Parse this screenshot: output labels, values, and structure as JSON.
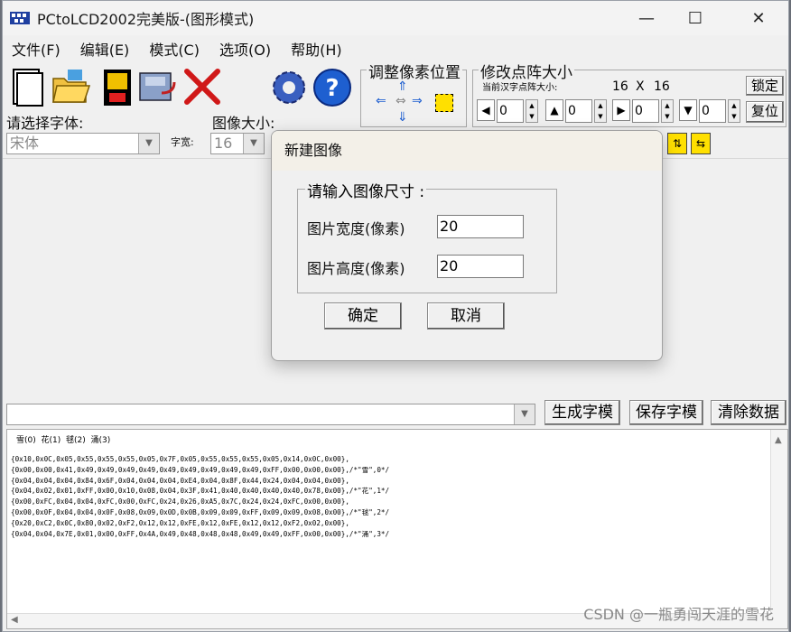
{
  "window": {
    "title": "PCtoLCD2002完美版-(图形模式)",
    "minimize": "—",
    "maximize": "☐",
    "close": "✕"
  },
  "menu": [
    "文件(F)",
    "编辑(E)",
    "模式(C)",
    "选项(O)",
    "帮助(H)"
  ],
  "pixel_group": {
    "title": "调整像素位置"
  },
  "matrix_group": {
    "title": "修改点阵大小",
    "current_label": "当前汉字点阵大小:",
    "current_w": "16",
    "x_sep": "X",
    "current_h": "16",
    "lock_button": "锁定",
    "reset_button": "复位",
    "spin_values": [
      "0",
      "0",
      "0",
      "0"
    ]
  },
  "font_select": {
    "label": "请选择字体:",
    "value": "宋体"
  },
  "width_select": {
    "label": "字宽:",
    "value": "16"
  },
  "image_size_label": "图像大小:",
  "bottom": {
    "generate": "生成字模",
    "save": "保存字模",
    "clear": "清除数据"
  },
  "output": {
    "chars": [
      "雪(0)",
      "花(1)",
      "毬(2)",
      "涌(3)"
    ],
    "lines": [
      "{0x10,0x0C,0x05,0x55,0x55,0x55,0x05,0x7F,0x05,0x55,0x55,0x55,0x05,0x14,0x0C,0x00},",
      "{0x00,0x00,0x41,0x49,0x49,0x49,0x49,0x49,0x49,0x49,0x49,0x49,0xFF,0x00,0x00,0x00},/*\"雪\",0*/",
      "{0x04,0x04,0x04,0x84,0x6F,0x04,0x04,0x04,0xE4,0x04,0x8F,0x44,0x24,0x04,0x04,0x00},",
      "{0x04,0x02,0x01,0xFF,0x00,0x10,0x08,0x04,0x3F,0x41,0x40,0x40,0x40,0x40,0x78,0x00},/*\"花\",1*/",
      "{0x00,0xFC,0x04,0x04,0xFC,0x00,0xFC,0x24,0x26,0xA5,0x7C,0x24,0x24,0xFC,0x00,0x00},",
      "{0x00,0x0F,0x04,0x04,0x0F,0x08,0x09,0x0D,0x0B,0x09,0x09,0xFF,0x09,0x09,0x08,0x00},/*\"毬\",2*/",
      "{0x20,0xC2,0x0C,0x80,0x02,0xF2,0x12,0x12,0xFE,0x12,0xFE,0x12,0x12,0xF2,0x02,0x00},",
      "{0x04,0x04,0x7E,0x01,0x00,0xFF,0x4A,0x49,0x48,0x48,0x48,0x49,0x49,0xFF,0x00,0x00},/*\"涌\",3*/"
    ]
  },
  "watermark": "CSDN @一瓶勇闯天涯的雪花",
  "dialog": {
    "title": "新建图像",
    "group_title": "请输入图像尺寸 :",
    "width_label": "图片宽度(像素)",
    "width_value": "20",
    "height_label": "图片高度(像素)",
    "height_value": "20",
    "ok": "确定",
    "cancel": "取消"
  }
}
